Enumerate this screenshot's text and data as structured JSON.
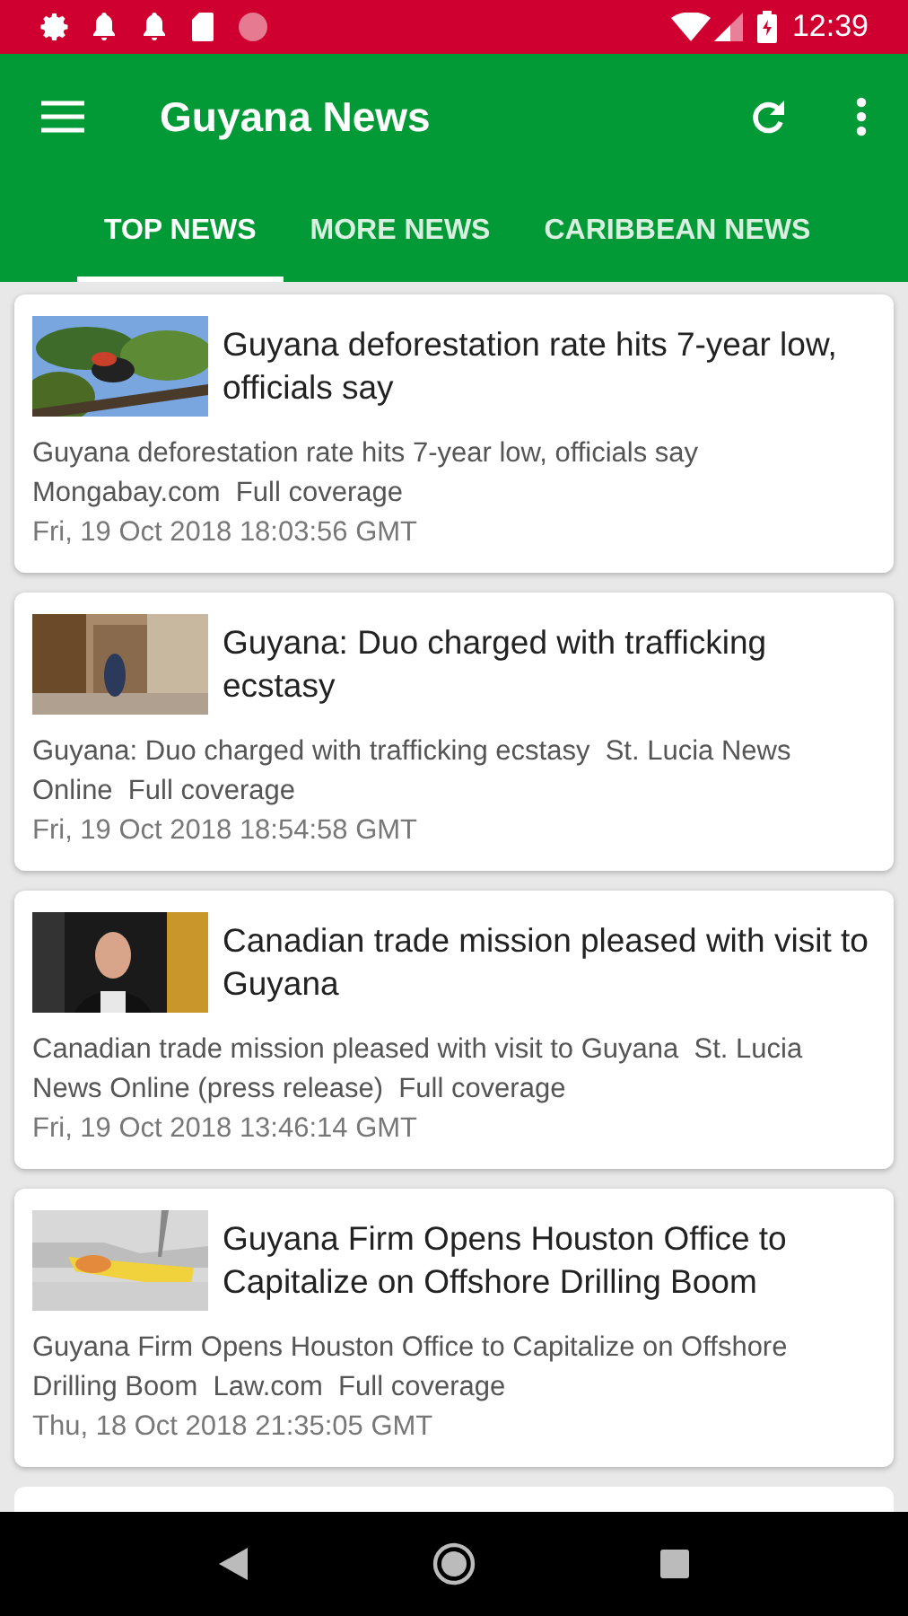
{
  "status_bar": {
    "time": "12:39"
  },
  "app_bar": {
    "title": "Guyana News"
  },
  "tabs": [
    {
      "label": "TOP NEWS",
      "selected": true
    },
    {
      "label": "MORE NEWS",
      "selected": false
    },
    {
      "label": "CARIBBEAN NEWS",
      "selected": false
    }
  ],
  "articles": [
    {
      "title": "Guyana deforestation rate hits 7-year low, officials say",
      "summary": "Guyana deforestation rate hits 7-year low, officials say  Mongabay.com  Full coverage",
      "date": "Fri, 19 Oct 2018 18:03:56 GMT"
    },
    {
      "title": "Guyana: Duo charged with trafficking ecstasy",
      "summary": "Guyana: Duo charged with trafficking ecstasy  St. Lucia News Online  Full coverage",
      "date": "Fri, 19 Oct 2018 18:54:58 GMT"
    },
    {
      "title": "Canadian trade mission pleased with visit to Guyana",
      "summary": "Canadian trade mission pleased with visit to Guyana  St. Lucia News Online (press release)  Full coverage",
      "date": "Fri, 19 Oct 2018 13:46:14 GMT"
    },
    {
      "title": "Guyana Firm Opens Houston Office to Capitalize on Offshore Drilling Boom",
      "summary": "Guyana Firm Opens Houston Office to Capitalize on Offshore Drilling Boom  Law.com  Full coverage",
      "date": "Thu, 18 Oct 2018 21:35:05 GMT"
    }
  ]
}
